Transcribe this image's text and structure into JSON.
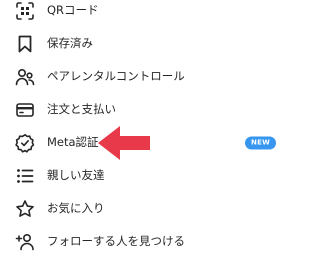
{
  "menu": {
    "items": [
      {
        "label": "QRコード",
        "icon": "qr-code-icon"
      },
      {
        "label": "保存済み",
        "icon": "bookmark-icon"
      },
      {
        "label": "ペアレンタルコントロール",
        "icon": "parental-control-icon"
      },
      {
        "label": "注文と支払い",
        "icon": "credit-card-icon"
      },
      {
        "label": "Meta認証",
        "icon": "verified-badge-icon",
        "badge": "NEW"
      },
      {
        "label": "親しい友達",
        "icon": "close-friends-list-icon"
      },
      {
        "label": "お気に入り",
        "icon": "star-icon"
      },
      {
        "label": "フォローする人を見つける",
        "icon": "add-person-icon"
      }
    ]
  },
  "colors": {
    "text": "#262626",
    "badge": "#3797f0",
    "arrow": "#e8394a"
  }
}
